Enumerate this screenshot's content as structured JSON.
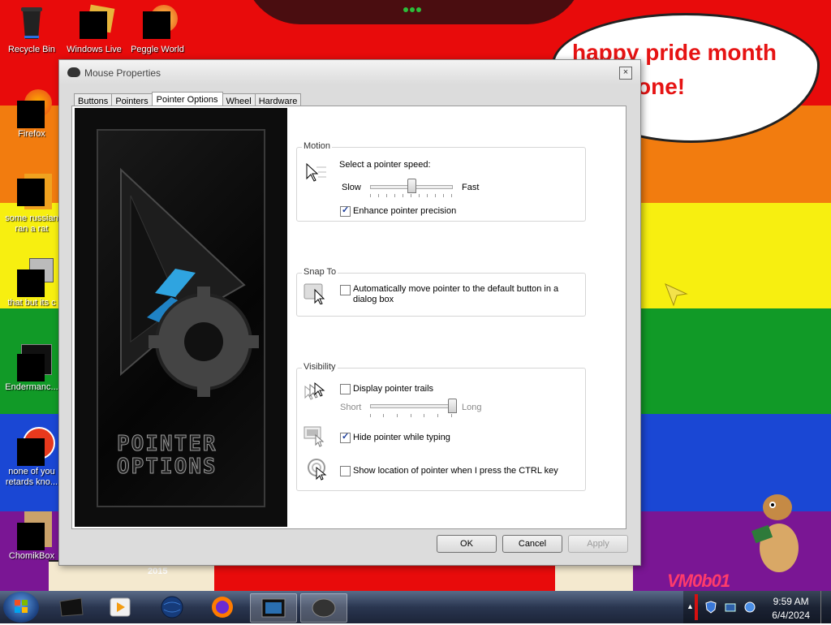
{
  "wallpaper": {
    "bubble_line1": "happy pride month",
    "bubble_line2": "one!",
    "year": "2015",
    "signature": "VM0b01"
  },
  "desktop_icons": [
    {
      "label": "Recycle Bin",
      "icon": "recycle-bin-icon"
    },
    {
      "label": "Windows Live",
      "icon": "windows-live-icon"
    },
    {
      "label": "Peggle World",
      "icon": "peggle-icon"
    },
    {
      "label": "Firefox",
      "icon": "firefox-icon"
    },
    {
      "label": "some russian ran a rat",
      "icon": "file-icon"
    },
    {
      "label": "that but its c",
      "icon": "shortcut-icon"
    },
    {
      "label": "Endermanc...",
      "icon": "app-icon"
    },
    {
      "label": "none of you retards kno...",
      "icon": "app-icon"
    },
    {
      "label": "ChomikBox",
      "icon": "chomikbox-icon"
    }
  ],
  "window": {
    "title": "Mouse Properties",
    "close_glyph": "×",
    "tabs": [
      "Buttons",
      "Pointers",
      "Pointer Options",
      "Wheel",
      "Hardware"
    ],
    "active_tab": "Pointer Options",
    "artwork_text_line1": "POINTER",
    "artwork_text_line2": "OPTIONS",
    "motion": {
      "title": "Motion",
      "prompt": "Select a pointer speed:",
      "slow": "Slow",
      "fast": "Fast",
      "speed_level": 0.5,
      "enhance_label": "Enhance pointer precision",
      "enhance_checked": true
    },
    "snap_to": {
      "title": "Snap To",
      "label": "Automatically move pointer to the default button in a dialog box",
      "checked": false
    },
    "visibility": {
      "title": "Visibility",
      "trails_label": "Display pointer trails",
      "trails_checked": false,
      "short": "Short",
      "long": "Long",
      "trail_level": 1.0,
      "hide_label": "Hide pointer while typing",
      "hide_checked": true,
      "ctrl_label": "Show location of pointer when I press the CTRL key",
      "ctrl_checked": false
    },
    "buttons": {
      "ok": "OK",
      "cancel": "Cancel",
      "apply": "Apply"
    }
  },
  "taskbar": {
    "items": [
      "start-orb",
      "explorer-icon",
      "media-player-icon",
      "globe-icon",
      "firefox-icon",
      "mouse-properties-window-icon",
      "mouse-icon"
    ],
    "time": "9:59 AM",
    "date": "6/4/2024"
  }
}
